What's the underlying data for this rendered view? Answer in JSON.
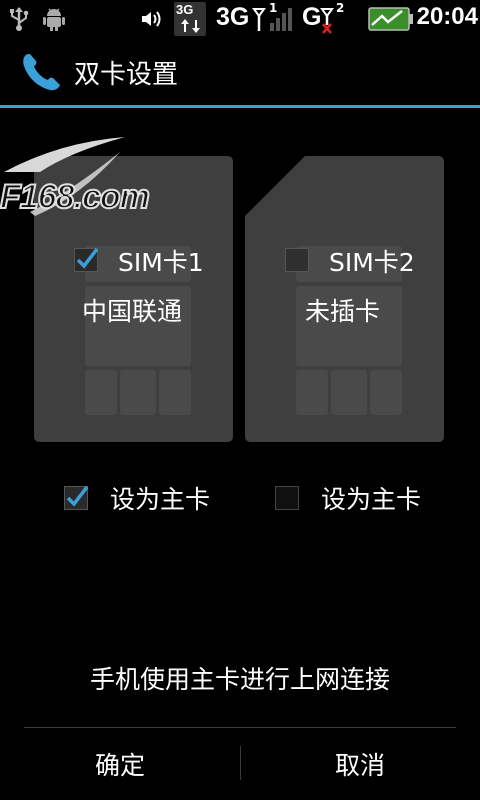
{
  "status": {
    "time": "20:04",
    "net1": "3G",
    "net2": "G",
    "net1_badge": "3G",
    "sim1_index": "1",
    "sim2_index": "2"
  },
  "title": "双卡设置",
  "watermark": "F168.com",
  "sim1": {
    "label": "SIM卡1",
    "carrier": "中国联通",
    "checked": true,
    "primary_checked": true
  },
  "sim2": {
    "label": "SIM卡2",
    "carrier": "未插卡",
    "checked": false,
    "primary_checked": false
  },
  "primary_label": "设为主卡",
  "footer_note": "手机使用主卡进行上网连接",
  "buttons": {
    "ok": "确定",
    "cancel": "取消"
  },
  "colors": {
    "accent": "#3aa0d8",
    "card": "#3f3f3f",
    "chip": "#4a4a4a"
  }
}
